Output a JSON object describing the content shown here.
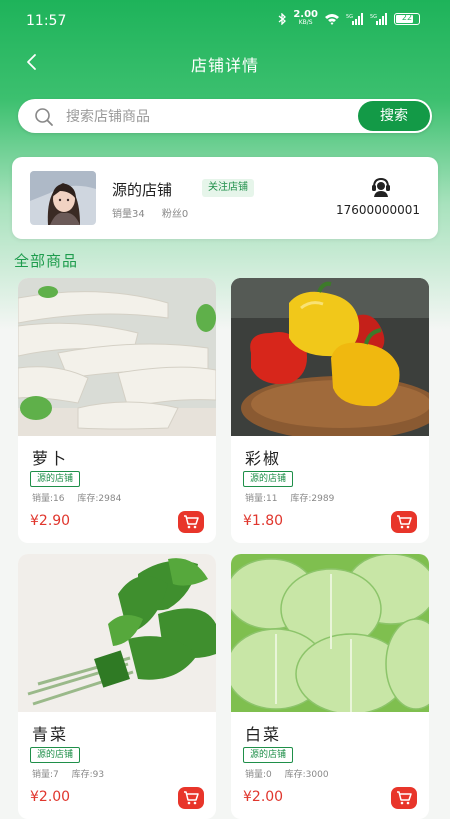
{
  "status": {
    "time": "11:57",
    "speed": "2.00",
    "speed_unit": "KB/S",
    "battery": "22"
  },
  "nav": {
    "title": "店铺详情"
  },
  "search": {
    "placeholder": "搜索店铺商品",
    "button": "搜索"
  },
  "shop": {
    "name": "源的店铺",
    "follow": "关注店铺",
    "sales": "销量34",
    "fans": "粉丝0",
    "phone": "17600000001"
  },
  "section_title": "全部商品",
  "products": [
    {
      "name": "萝卜",
      "tag": "源的店铺",
      "sales": "销量:16",
      "stock": "库存:2984",
      "price": "¥2.90"
    },
    {
      "name": "彩椒",
      "tag": "源的店铺",
      "sales": "销量:11",
      "stock": "库存:2989",
      "price": "¥1.80"
    },
    {
      "name": "青菜",
      "tag": "源的店铺",
      "sales": "销量:7",
      "stock": "库存:93",
      "price": "¥2.00"
    },
    {
      "name": "白菜",
      "tag": "源的店铺",
      "sales": "销量:0",
      "stock": "库存:3000",
      "price": "¥2.00"
    }
  ],
  "colors": {
    "primary": "#139a47",
    "price": "#e0362d",
    "cart": "#e8352a"
  },
  "icons": {
    "back": "chevron-left-icon",
    "search": "search-icon",
    "service": "customer-service-icon",
    "cart": "cart-icon"
  }
}
